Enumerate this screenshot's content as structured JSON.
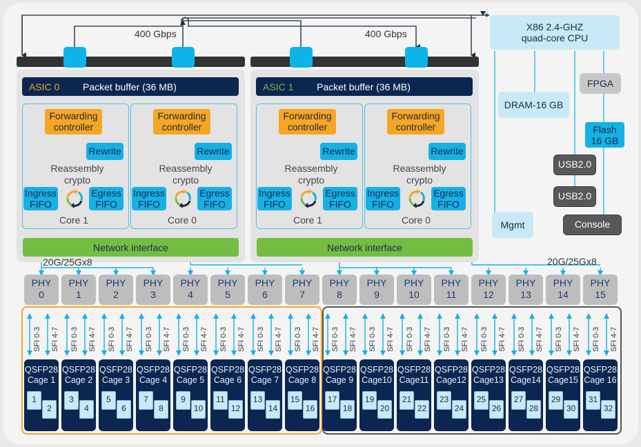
{
  "top_links": {
    "left_bandwidth": "400 Gbps",
    "right_bandwidth": "400 Gbps"
  },
  "asics": [
    {
      "name": "ASIC 0",
      "name_color": "#f5a623",
      "packet_buffer": "Packet buffer (36 MB)",
      "cores": [
        {
          "forwarding": "Forwarding controller",
          "rewrite": "Rewrite",
          "reassembly": "Reassembly",
          "crypto": "crypto",
          "ingress_fifo": "Ingress FIFO",
          "egress_fifo": "Egress FIFO",
          "core_label": "Core 1"
        },
        {
          "forwarding": "Forwarding controller",
          "rewrite": "Rewrite",
          "reassembly": "Reassembly",
          "crypto": "crypto",
          "ingress_fifo": "Ingress FIFO",
          "egress_fifo": "Egress FIFO",
          "core_label": "Core 0"
        }
      ],
      "network_interface": "Network interface",
      "link_label": "20G/25Gx8"
    },
    {
      "name": "ASIC 1",
      "name_color": "#74bd43",
      "packet_buffer": "Packet buffer (36 MB)",
      "cores": [
        {
          "forwarding": "Forwarding controller",
          "rewrite": "Rewrite",
          "reassembly": "Reassembly",
          "crypto": "crypto",
          "ingress_fifo": "Ingress FIFO",
          "egress_fifo": "Egress FIFO",
          "core_label": "Core 1"
        },
        {
          "forwarding": "Forwarding controller",
          "rewrite": "Rewrite",
          "reassembly": "Reassembly",
          "crypto": "crypto",
          "ingress_fifo": "Ingress FIFO",
          "egress_fifo": "Egress FIFO",
          "core_label": "Core 0"
        }
      ],
      "network_interface": "Network interface",
      "link_label": "20G/25Gx8"
    }
  ],
  "cpu_complex": {
    "cpu": "X86 2.4-GHZ quad-core CPU",
    "cpu_line1": "X86 2.4-GHZ",
    "cpu_line2": "quad-core CPU",
    "dram": "DRAM-16 GB",
    "fpga": "FPGA",
    "flash_line1": "Flash",
    "flash_line2": "16 GB",
    "usb1": "USB2.0",
    "usb2": "USB2.0",
    "mgmt": "Mgmt",
    "console": "Console"
  },
  "phys": [
    {
      "label": "PHY",
      "num": "0"
    },
    {
      "label": "PHY",
      "num": "1"
    },
    {
      "label": "PHY",
      "num": "2"
    },
    {
      "label": "PHY",
      "num": "3"
    },
    {
      "label": "PHY",
      "num": "4"
    },
    {
      "label": "PHY",
      "num": "5"
    },
    {
      "label": "PHY",
      "num": "6"
    },
    {
      "label": "PHY",
      "num": "7"
    },
    {
      "label": "PHY",
      "num": "8"
    },
    {
      "label": "PHY",
      "num": "9"
    },
    {
      "label": "PHY",
      "num": "10"
    },
    {
      "label": "PHY",
      "num": "11"
    },
    {
      "label": "PHY",
      "num": "12"
    },
    {
      "label": "PHY",
      "num": "13"
    },
    {
      "label": "PHY",
      "num": "14"
    },
    {
      "label": "PHY",
      "num": "15"
    }
  ],
  "sfi_labels": [
    "SFI 0-3",
    "SFI 4-7"
  ],
  "cages": [
    {
      "type": "QSFP28",
      "name": "Cage 1",
      "ports": [
        "1",
        "2"
      ]
    },
    {
      "type": "QSFP28",
      "name": "Cage 2",
      "ports": [
        "3",
        "4"
      ]
    },
    {
      "type": "QSFP28",
      "name": "Cage 3",
      "ports": [
        "5",
        "6"
      ]
    },
    {
      "type": "QSFP28",
      "name": "Cage 4",
      "ports": [
        "7",
        "8"
      ]
    },
    {
      "type": "QSFP28",
      "name": "Cage 5",
      "ports": [
        "9",
        "10"
      ]
    },
    {
      "type": "QSFP28",
      "name": "Cage 6",
      "ports": [
        "11",
        "12"
      ]
    },
    {
      "type": "QSFP28",
      "name": "Cage 7",
      "ports": [
        "13",
        "14"
      ]
    },
    {
      "type": "QSFP28",
      "name": "Cage 8",
      "ports": [
        "15",
        "16"
      ]
    },
    {
      "type": "QSFP28",
      "name": "Cage 9",
      "ports": [
        "17",
        "18"
      ]
    },
    {
      "type": "QSFP28",
      "name": "Cage10",
      "ports": [
        "19",
        "20"
      ]
    },
    {
      "type": "QSFP28",
      "name": "Cage11",
      "ports": [
        "21",
        "22"
      ]
    },
    {
      "type": "QSFP28",
      "name": "Cage12",
      "ports": [
        "23",
        "24"
      ]
    },
    {
      "type": "QSFP28",
      "name": "Cage13",
      "ports": [
        "25",
        "26"
      ]
    },
    {
      "type": "QSFP28",
      "name": "Cage14",
      "ports": [
        "27",
        "28"
      ]
    },
    {
      "type": "QSFP28",
      "name": "Cage15",
      "ports": [
        "29",
        "30"
      ]
    },
    {
      "type": "QSFP28",
      "name": "Cage 16",
      "ports": [
        "31",
        "32"
      ]
    }
  ],
  "colors": {
    "accent_blue": "#14b1e6",
    "forwarding_orange": "#f5a623",
    "network_green": "#74bd43",
    "navy": "#0b2650"
  }
}
